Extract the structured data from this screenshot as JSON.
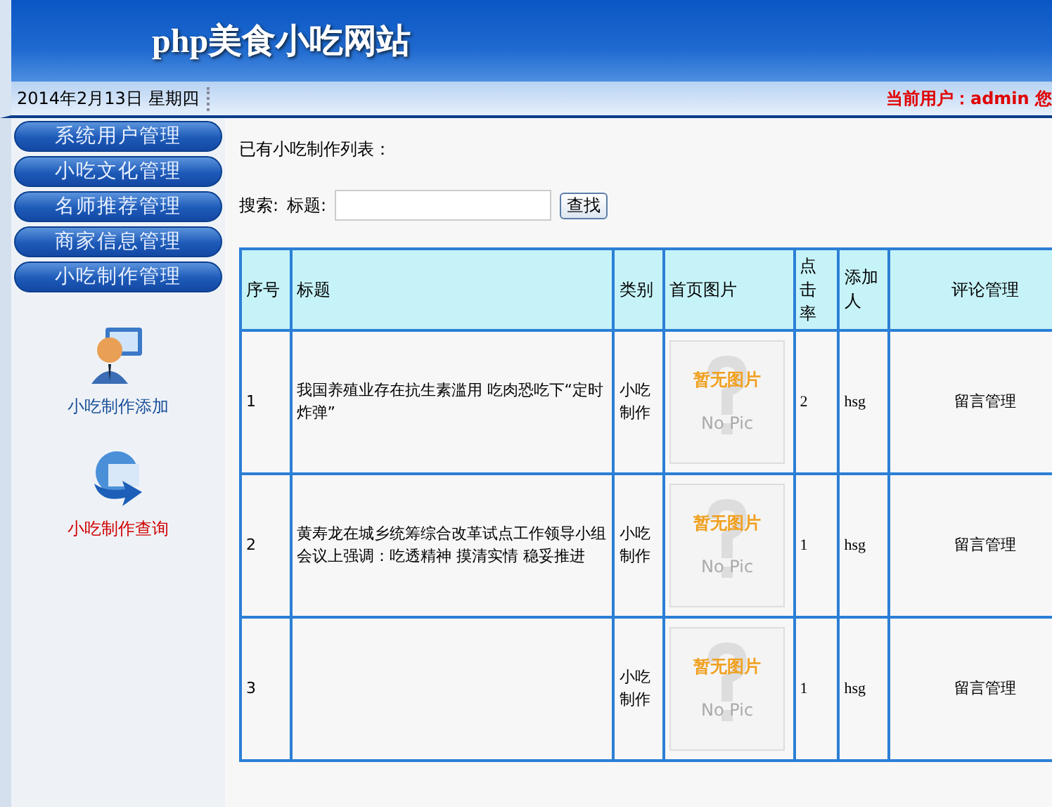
{
  "header": {
    "title": "php美食小吃网站"
  },
  "info_bar": {
    "date": "2014年2月13日 星期四",
    "user": "当前用户：admin 您"
  },
  "sidebar": {
    "menu": [
      {
        "label": "系统用户管理"
      },
      {
        "label": "小吃文化管理"
      },
      {
        "label": "名师推荐管理"
      },
      {
        "label": "商家信息管理"
      },
      {
        "label": "小吃制作管理"
      }
    ],
    "links": [
      {
        "kind": "add",
        "label": "小吃制作添加",
        "selected": false
      },
      {
        "kind": "query",
        "label": "小吃制作查询",
        "selected": true
      }
    ]
  },
  "content": {
    "heading": "已有小吃制作列表：",
    "search_label": "搜索:",
    "field_label": "标题:",
    "search_button": "查找"
  },
  "table": {
    "columns": [
      "序号",
      "标题",
      "类别",
      "首页图片",
      "点击率",
      "添加人",
      "评论管理"
    ],
    "rows": [
      {
        "index": "1",
        "title": "我国养殖业存在抗生素滥用 吃肉恐吃下“定时炸弹”",
        "category": "小吃制作",
        "image_text": "暂无图片",
        "image_caption": "No Pic",
        "hits": "2",
        "author": "hsg",
        "action": "留言管理"
      },
      {
        "index": "2",
        "title": "黄寿龙在城乡统筹综合改革试点工作领导小组会议上强调：吃透精神 摸清实情 稳妥推进",
        "category": "小吃制作",
        "image_text": "暂无图片",
        "image_caption": "No Pic",
        "hits": "1",
        "author": "hsg",
        "action": "留言管理"
      },
      {
        "index": "3",
        "category": "小吃制作",
        "image_text": "暂无图片",
        "image_caption": "No Pic",
        "hits": "1",
        "author": "hsg",
        "action": "留言管理"
      }
    ]
  }
}
